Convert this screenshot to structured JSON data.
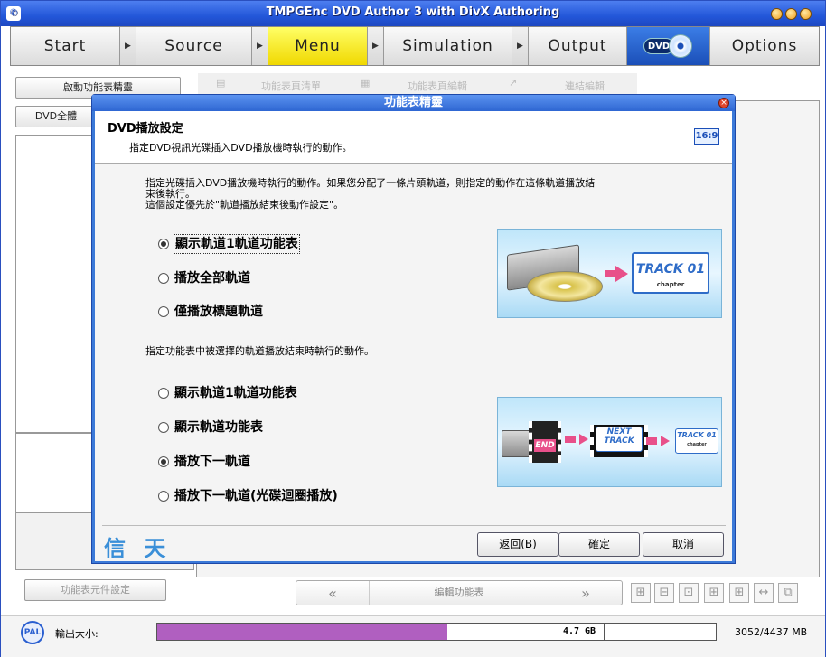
{
  "window": {
    "title": "TMPGEnc DVD Author 3 with DivX Authoring",
    "icon": "app-logo-icon"
  },
  "nav": {
    "steps": [
      "Start",
      "Source",
      "Menu",
      "Simulation",
      "Output"
    ],
    "active": "Menu",
    "logo_label": "DVD",
    "options": "Options"
  },
  "left": {
    "wizard_button": "啟動功能表精靈",
    "dvd_all_button": "DVD全體",
    "component_button": "功能表元件設定"
  },
  "toolbar": {
    "items": [
      "功能表頁清單",
      "功能表頁編輯",
      "連結編輯"
    ]
  },
  "bottom": {
    "prev": "«",
    "edit_menu": "編輯功能表",
    "next": "»"
  },
  "status": {
    "format": "PAL",
    "size_label": "輸出大小:",
    "capacity_text": "4.7 GB",
    "fill_fraction": 0.52,
    "mb_text": "3052/4437 MB"
  },
  "dialog": {
    "title": "功能表精靈",
    "header_title": "DVD播放設定",
    "header_subtitle": "指定DVD視訊光碟插入DVD播放機時執行的動作。",
    "aspect": "16:9",
    "desc1_line1": "指定光碟插入DVD播放機時執行的動作。如果您分配了一條片頭軌道，則指定的動作在這條軌道播放結",
    "desc1_line2": "束後執行。",
    "desc1_line3": "這個設定優先於\"軌道播放結束後動作設定\"。",
    "group1": [
      {
        "label": "顯示軌道1軌道功能表",
        "selected": true
      },
      {
        "label": "播放全部軌道",
        "selected": false
      },
      {
        "label": "僅播放標題軌道",
        "selected": false
      }
    ],
    "desc2": "指定功能表中被選擇的軌道播放結束時執行的動作。",
    "group2": [
      {
        "label": "顯示軌道1軌道功能表",
        "selected": false
      },
      {
        "label": "顯示軌道功能表",
        "selected": false
      },
      {
        "label": "播放下一軌道",
        "selected": true
      },
      {
        "label": "播放下一軌道(光碟迴圈播放)",
        "selected": false
      }
    ],
    "illus1": {
      "track": "TRACK 01",
      "chapter": "chapter"
    },
    "illus2": {
      "end": "END",
      "next_line1": "NEXT",
      "next_line2": "TRACK",
      "track": "TRACK 01",
      "chapter": "chapter"
    },
    "watermark": "信 天",
    "buttons": {
      "back": "返回(B)",
      "ok": "確定",
      "cancel": "取消"
    }
  }
}
